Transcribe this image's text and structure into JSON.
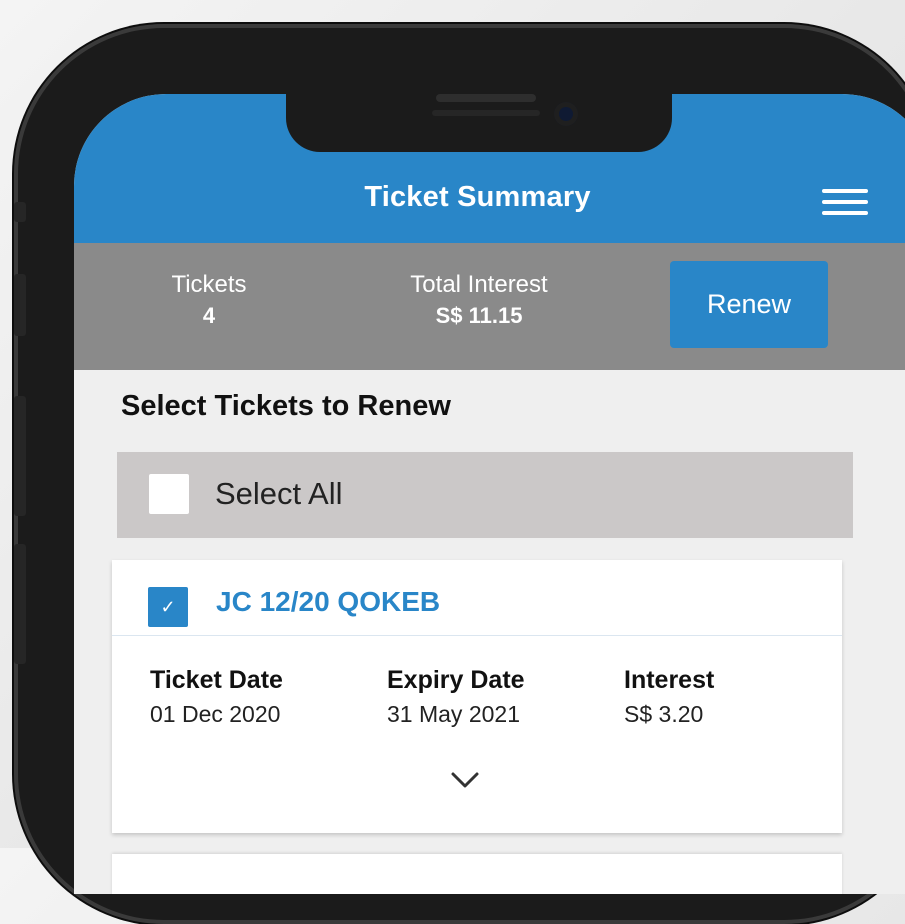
{
  "header": {
    "title": "Ticket Summary",
    "menu_icon": "hamburger-menu-icon"
  },
  "summary": {
    "tickets_label": "Tickets",
    "tickets_value": "4",
    "interest_label": "Total Interest",
    "interest_value": "S$ 11.15",
    "renew_label": "Renew"
  },
  "section": {
    "title": "Select Tickets to Renew"
  },
  "select_all": {
    "label": "Select All",
    "checked": false
  },
  "tickets": [
    {
      "id": "JC 12/20 QOKEB",
      "checked": true,
      "fields": [
        {
          "label": "Ticket Date",
          "value": "01 Dec 2020"
        },
        {
          "label": "Expiry Date",
          "value": "31 May 2021"
        },
        {
          "label": "Interest",
          "value": "S$ 3.20"
        }
      ],
      "expand_icon": "chevron-down-icon"
    }
  ],
  "colors": {
    "primary": "#2986c8",
    "summary_bar": "#8a8a8a",
    "select_all_bg": "#cbc8c8",
    "screen_bg": "#efefef"
  }
}
